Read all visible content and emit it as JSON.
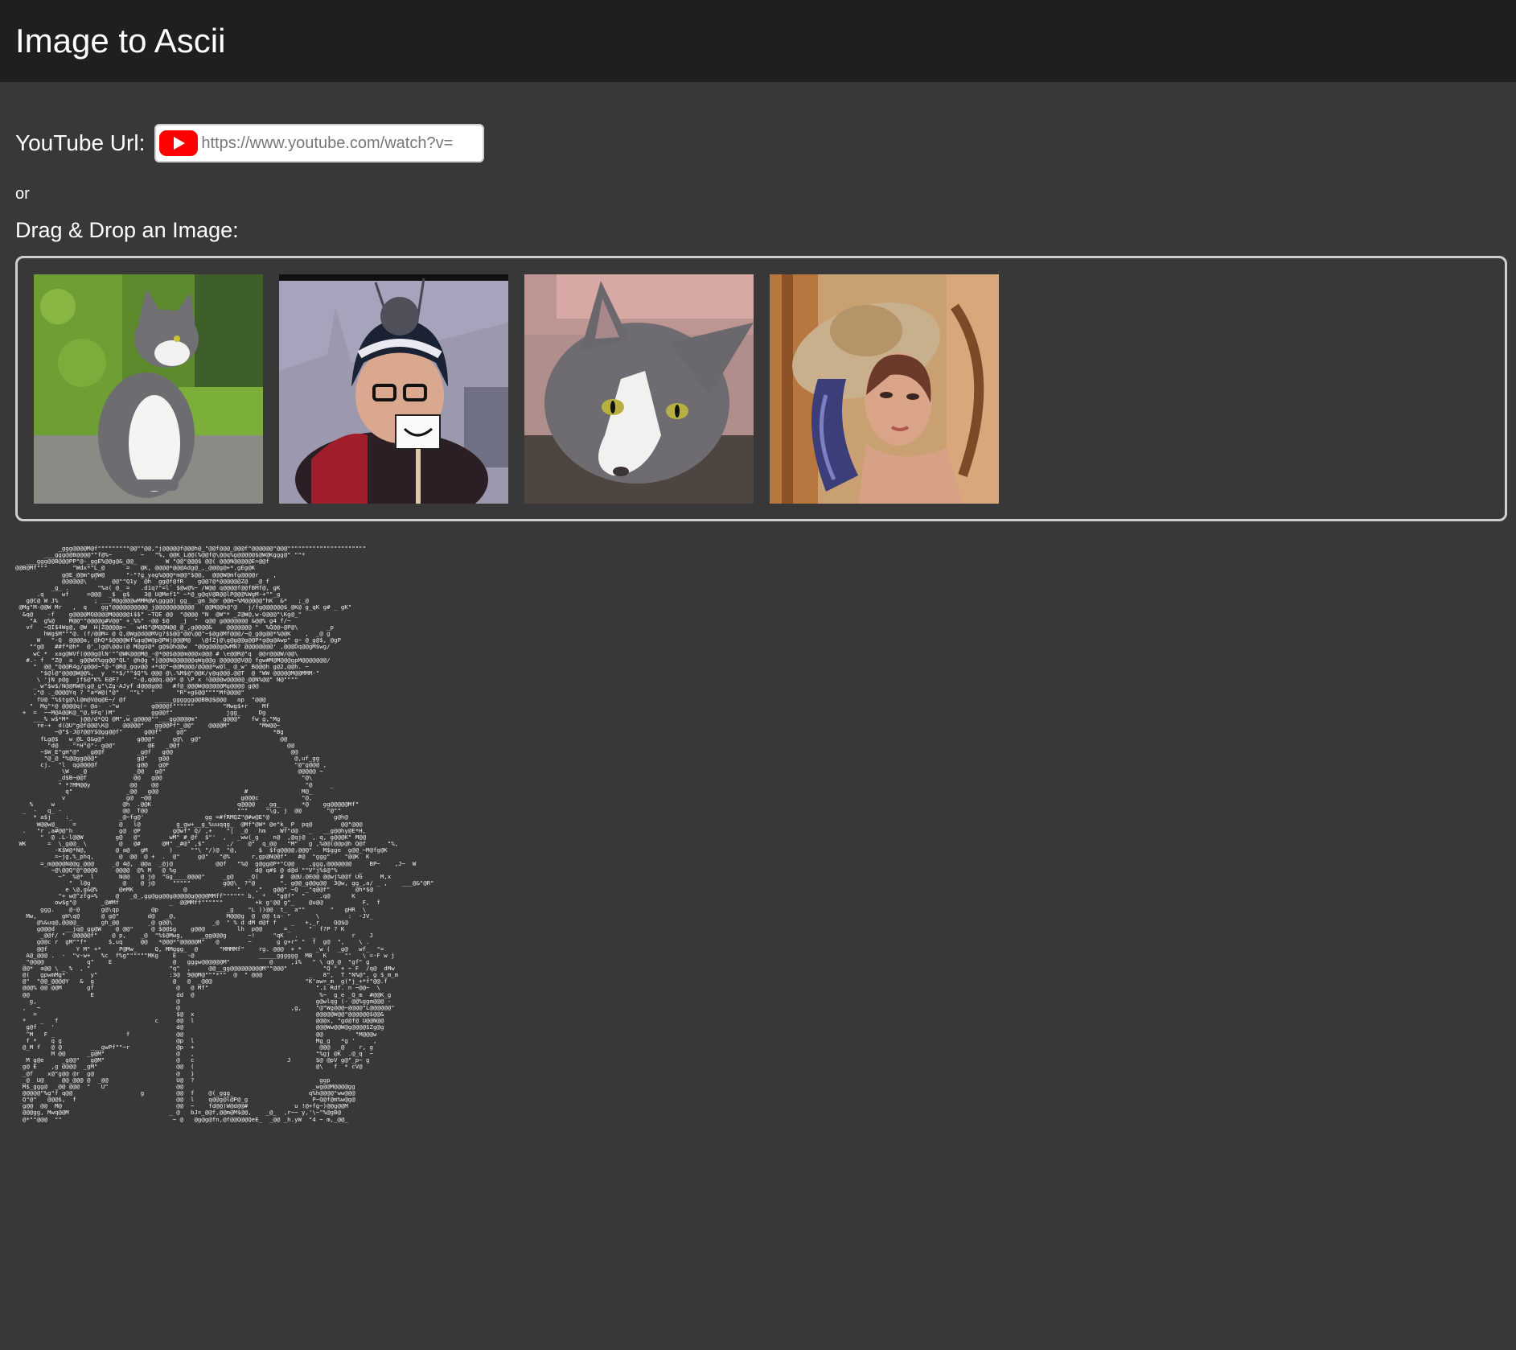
{
  "header": {
    "title": "Image to Ascii"
  },
  "youtube": {
    "label": "YouTube Url:",
    "placeholder": "https://www.youtube.com/watch?v=",
    "icon": "youtube-logo-icon",
    "brand_color": "#ff0000"
  },
  "or_text": "or",
  "dragdrop": {
    "label": "Drag & Drop an Image:"
  },
  "sample_images": [
    {
      "name": "sample-image-cat-garden"
    },
    {
      "name": "sample-image-person-smile-sign"
    },
    {
      "name": "sample-image-cat-closeup"
    },
    {
      "name": "sample-image-woman-hat"
    }
  ],
  "ascii_output": "            _ggg@@@@M@f\"\"\"\"\"\"\"\"\"@@\"\"@@,\"j@@@@@f@@@h@_\"@@f@@@_@@@f\"@@@@@@\"@@@\"\"\"\"\"\"\"\"\"\"\"\"\"\"\"\"\"\"\"\"\"\"\n        ___ggg@@B@@@@\"\"f@%~        ~   \"%, @@K_L@@(%@@f@\\@@q%g@@@@@$@W@Kggg@\" \"\"*\n   ___ggg@@B@@@PP\"@-_ggE%@@g@&_@@_        W \"@@\"@@@$ @@( @@@N@@@@@E=@@f\n@@B@Mf\"\"\"       \"Wdx*\"L_@      =   @K, @@@@*@@@Adg@_,_@@@g@+*.gEg@K\n             g@E_@@m\"g@W@      \"-\"?g_yag%@@@*m@@\"$@@,  @@@W@mfg@@@@r    ,\n             @@@@@@\\  `    @@\"\"Q1y  @h  gg@f@fR    g@@?@*@@@@@@Z@  _@ f\n          _g_ .        \"%a( @_ =   .d1q?\"=l` $@w@%~ /W@@ q@@@@f@@fBMf@, gK\n      .q     wf     =@@@  _$  g$    3@ U@Mef1\" ~*@_g@qV@B@@lP@@@%WgM-+\"\"_g\n   g@C@ W J%          ; ___M@g@@@wMMM@W\\ggg@| gg_ _gm 3@r @@m~%M@@@@@\"hK  &*   ;_@\n @Mg\"M-@@W Mr   ,  q    gg\"@@@@@@@@@@_j@@@@@@@@@@@  `@@M@@h@\"@   j/fg@@@@@@$_@K@ g_qK g# _ gK\"\n  &q@    -f    g@@@@MQ@@@@M@@@@@i$$\" ~TQE @@  \"@@@@ \"N  @W\"* _Z@W@,w-Q@@@\"\\Kg@_\"\n    \"A  g%@    M@@\"\"@@@@g#V@@\" +_%%\" -@@ $@   _j  \"  q@@ g@@@@@@@ &@@% g4 f/~\n   vf   ~QI$4Wg@, @W  H|Z@@@@p~   wHQ\"@M@@N@@_@_,g@@@@&    @@@@@@@ \"  %Q@@~@P@\\        _p\n        hWg$M\"\"\"@. (f/@@M= @ Q,@Wg@d@@MVg?$$@@\"@@\\@@\"~$@g@Mf@@@/~@_g@g@@*%@@K    ,  _@ g\n      W   \"-Q  @@@@a, @hQ*$@@@@Wf%gq@W@p@PWj@@@M@   \\@fZj@\\g@g@@g@@P*g@g@Awp\" g~ @_g@$, @gP\n    \"\"g@   ##f*@h*  @'_)g@\\@@u(@ M@gU@* g@$@h@@w  \"@@g@@@g@wMN? @@@@@@@@' ,@@@Dq@@gM$wg/\n     wC *  xag@WVf(@@@g@lN'\"^@WK@@@M@_-@*@@$@@@m@@@x@@@ # \\e@@R@\"q  @@r@@@W/@@\\\n   #.- f  \"Z@  a  g@@WX%gg@@\"QL' @h@g *]@@@N@@@@@@qWg@@g @@@@@@V@@ fgw#M@M@@@gpM@@@@@@@/\n     \"  @@_\"Q@@R4g/g@@d~\"@-\"@R@_gqv@@ +*d@\"~@@M@@@/@@@@*w@l_ @_w' B@@@h g@2,@@h. ~\n       \"$@l@\"@@@@W@@%,  y  \"*$/\"\"$Q\"% @@@ @\\.%M$@\"@@K/y@q@@@.@@T  @ \"WW @@@@@M@@MMM-\"\n      \\ 'jN p@g  jf$@\"K% E@F?    \"-@,q@@q.@@* @ \\P x !@@@@w@@@@@_@@N%@@\" N@\"\"\"\"\n     _ w\"$w$/N@@RW@\\g@_g\"\\Zg-AJyf d@@@g@@   #f@_@@@W@@@@@@Mg@@@@ g@@\n     ,\"@ ._@@@@Yq ? \"a*W@(\"@\"   \"\"L\"  \"      \"R\"+g$@@\"\"\"\"Mf@@@@\"\n      fU@ \"%$tg@\\l@m@V@q@E~/ @f        _____gggggg@@BB@$@@@   ap  \"@@@\n    \"  Mg\"*@ @@@@q(~ @a-  -\"w         g@@@@f\"\"\"\"\"\"        \"Mwg$+r    Mf\n  +  =  ~~M@A@@K@_\"@,9Fq')M\"   _      gg@@f\"               jgg_     Dg\n     ___% w$*M*   j@@/d*QQ @M\",w_g@@@@\"\"___gg@@@@m\"      _g@@@\"   fw g,\"Mg\n      re-+  d(@U\"g@f@@@\\K@    @@@@@\"   gg@@Pf\"_@@\"    @@@@M\"        \"MW@@~\n           ~@\"$-J@?@@Y$@gg@@f\"      g@@f\"    g@\"                        *Bg\n       fLg@$   w_@L_Q&g@\"         g@@@\"     g@\\  g@\"                      @@\n         \"d@    \"*H\"@\"- g@@\"         @E   _@@f                              @@\n       ~$W_E\"gH\"@\"  _g@@f         _g@f   g@@                                 @@\n        \"@_@ \"%@@gg@@@\"           g@\"   g@@                                   @,uf_gg\n       cj.  \"l  qg@@@@f           g@@   g@F                                   \"@\"g@@@ ,\n             \\W   _@             _@@   g@\"                                     @@@@@ ~\n            _d$B~@@f             @@   g@@                                       \"@\\\n            \" *?MM@@y           @@    @@                                         \"@     _\n              q\"               _@@   g@@                        #               M@_\n             v                 g@  ~@@                         g@@@c            \"@,\n    %     w                   @h  .@@K                        q@@@@   _gg_      *@    gg@@@@@Mf\"\n  _  -   q_ -                 @@  T@@                         \"\"\"     \"\\g, j  @@       \"@\"\"\n     * a$j    :_             _@~fg@'                 gg =#fRMQZ\"@#w@E\"@                  g@h@\n      W@@w@_    =            @   l@          g_gw+__g_%uuqqg_  @Mf\"@W* @e\"k_ P  pq@        @@\"@@@\n  .   \"r ,a#@@\"h             g@  @P         g@wf\" Q/ ,+    \"|  _@   hm    Wf\"d@   _   __g@@hy@E*H,\n       \"  @ .L-l@@W         g@   @\"        wM\" #_@f  $\"'  ,   _ww(_g    n@  ,@qj@  , q, g@@@K\" M@@\n WK      =  \\_g@@_ \\         @   @#      @M\" _#@\" ,$\"      ,/    @\"  q_@@   \"M\"   g ,%@@(@@p@h Q@f      \"%,\n           -K$W@*N@,        @ a@   gM      )     \"\"\\ \"/)@  \"@,      $  $fg@@@@.@@@\"   M$gge  g@@_~M@fg@K\n           =~jg,%_phq,       @  @@  @ +  .  @\"     g@\"   \"@%      r,gp@N@@f\"   #@  \"ggg\"    \"@@K  K\n       =_m@@@@N@@g_@@@     _@ 4@,  @@a  _@j@            @@f   \"%@  g@gg@P*\"C@@    ,ggg,@@@@@@@     BP~    ,J~  W\n          ~@\\@@Q\"@\"@@@Q     @@@@  @% M   @ %g                      d@ q#$ @ d@d \"\"V\"j%$@\"%      _\n            ~\"  %@*  l       N@@   @ j@  \"Gg____@@@@\"     _g@    _Q(      #  @@U.@E@@ @@wj%@@f UG     M,x\n               \"  l@g         @    @ j@     \"\"\"\"\"         g@@\\  ?\"@       \". g@@_g@@g@@  3@w, gg_,a/ _ ,    ___@&\"@R\"\n              e \\@,g&@%      @eMK              @              \"    ,\"   g@@\" ~Q  _\"q@@f\"       @h*$@\n            \"+ w@^zfg=%     @   _@_,gg@gg@@g@@@@@g@@@@MMff\"\"\"\"\"\" b,  *   \"g@f\"  \"    .q@      K\n           ow$g\"@       _@#Mf              _  @@MMff\"\"\"\"\"\"         +k g'@@ g\"_    @u@@           F,  f\n       ggg.    @-@      g@\\qp         @p                   _g    \"L ))@@  t_  a\"\"       \"   gHR  \\\n   Mw,       gH\\q@      @ g@\"        d@   _@,              M@@@g  @  @@ ta- \"       \\        :  -JV_\n      @%&uq@,@@@@_      gh_@@        _@ g@@\\           _@  \" % d dM d@f f    _   +,_r    Q@$@\n      g@@@d   __jq@_gg@W    @ @@\"     @ $@@$g    g@@@         lh  p@@      =_     \"  f?P ? K\n       _@@f/ \"  @@@@@f\"    @ p,    _@  \"%$@Mwg,     _gg@@@g      ~!     \"qK   .    _          r    J\n      g@@c r  gM\"\"f*      $,uq     @@   *@@@*\"@@@@@M\"   @        ~       g g+r\" \"  f  g@  \",    \\ .\n      @@f        Y M\" +*     P@Mw_     Q, MMggg_  @      \"MMMMf\"    rg. @@@  + *    _w (  _g@   wf_  \"=\n   A@_@@@ .  -  \"v-w+   %c  f%g\"\"\"\"\"\"MKg    E   -@                  _____gggggg  MB   K     \"'   \\ =-F w j\n  _\"@@@@            q\"    E                 @   gggw@@@@@@M\"           @     ,i%   \" \\ q@_@  \"gf\" g\n  @@*  a@@ \\ _ %  , \"                      \"q\"  ,     @@__gg@@@@@@@@@M\"\"@@@\"          \"Q \" + ~ F  /q@  dMw\n  @(   gpwmMg*`      y\"                    :3@  9@@M@\"\"\"*\"\"  @  \" @@@             _   8\",  T \"N%@\", g $_m_m\n  @\"  \"@@_@@@@Y   &  g                      @   @  _@@@                          \"K'aw=_m  g(\"j_+*f\"@@.f\n  @@@% @@ @@M       gf                       @   @ Mf\"                              \".i Rdf. n ~@@~  \\\n  @@                 E                       dd  @                                   %~  g_e _Q_m  #@@K_g\n    g,                                       @                                      g@wlqg (- @@%ggm@@@ -\n  ,   ~                                      @                               ,g,    \"@\"Wg@@@~@@@@\"L@@@@@@\"\n     =                                       $@  x                                  @@@@@W@@\"@@@@@@$@@&\n  *    _   f                           c     d@  l                                  @@@x, \"gd@f@ U@@N@@\n   g@f    '                                  d@                                     @@@Ww@@W@g@@@@$Zg@g\n   ^M   F _                    f             @@                                     @@         \"M@@@w\n   f *    q g                                @p  l                                  Mg_g   *g '     ,\n  @_M f   @ @        ___gwPf\"\"~r             @p  +                                   @@@  _@    r, g\n          M @@      _g@M\"                    @   ,                                  \"%gj @K  .@_q  ~\n   M g@e     _g@@\"   g@M\"                    @   c                          J       $@ @pV g@\"_p~ g\n  g@ E    ,g @@@@  _gM\"                      @@  (                                  @\\   f  * cV@\n  _@f    x@\"g@@ @r  g@                       @   }\n  _@  U@     @@_@@@ @  _@@                   U@  ?                                   ggp\n  M$_ggg@  _@@ @@@  \"   U\"                   @@                                    _wg@@M@@@@gg\n  @@@@@\"%g\"f q@@                   g         @@  f    @(_ggg_                     q%h@@@@\"ww@@@\n  Q\"@\"   @@@$,  f                            @@  l    q@@g@l@P@_g                  P~Q@f@m%w@g@\n  g@@  @@  M@                                @@  ~    fd@@)W@d@@#             u !@+fg~)@@g@@M\n  @@@gg, Mwq@@M                            _ @   bJ=_@@f,@@m@M$@@,    _@_  ,r~~ y,'\\~\"%@gB@\n  @*\"\"@@@  \"\"                               ~ @   @g@g@fn,@f@@Q@@QeE_  _@@ _h.yW  \"4 ~ m,_@@_"
}
